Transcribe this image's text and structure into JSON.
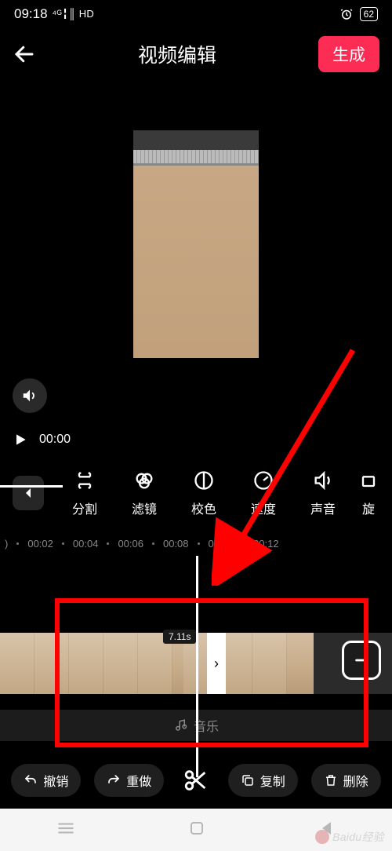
{
  "statusbar": {
    "time": "09:18",
    "signal": "⁴ᴳ╏║ HD",
    "battery": "62"
  },
  "header": {
    "title": "视频编辑",
    "generate": "生成"
  },
  "playback": {
    "time": "00:00"
  },
  "tools": {
    "items": [
      {
        "label": "分割",
        "icon": "split-icon"
      },
      {
        "label": "滤镜",
        "icon": "filter-icon"
      },
      {
        "label": "校色",
        "icon": "color-icon"
      },
      {
        "label": "速度",
        "icon": "speed-icon"
      },
      {
        "label": "声音",
        "icon": "volume-icon"
      },
      {
        "label": "旋",
        "icon": "rotate-icon"
      }
    ]
  },
  "ruler": {
    "marks": [
      ")",
      "00:02",
      "00:04",
      "00:06",
      "00:08",
      "00:10",
      "00:12"
    ]
  },
  "timeline": {
    "duration_badge": "7.11s",
    "music_label": "音乐"
  },
  "actions": {
    "undo": "撤销",
    "redo": "重做",
    "copy": "复制",
    "delete": "删除"
  },
  "watermark": "Baidu经验"
}
